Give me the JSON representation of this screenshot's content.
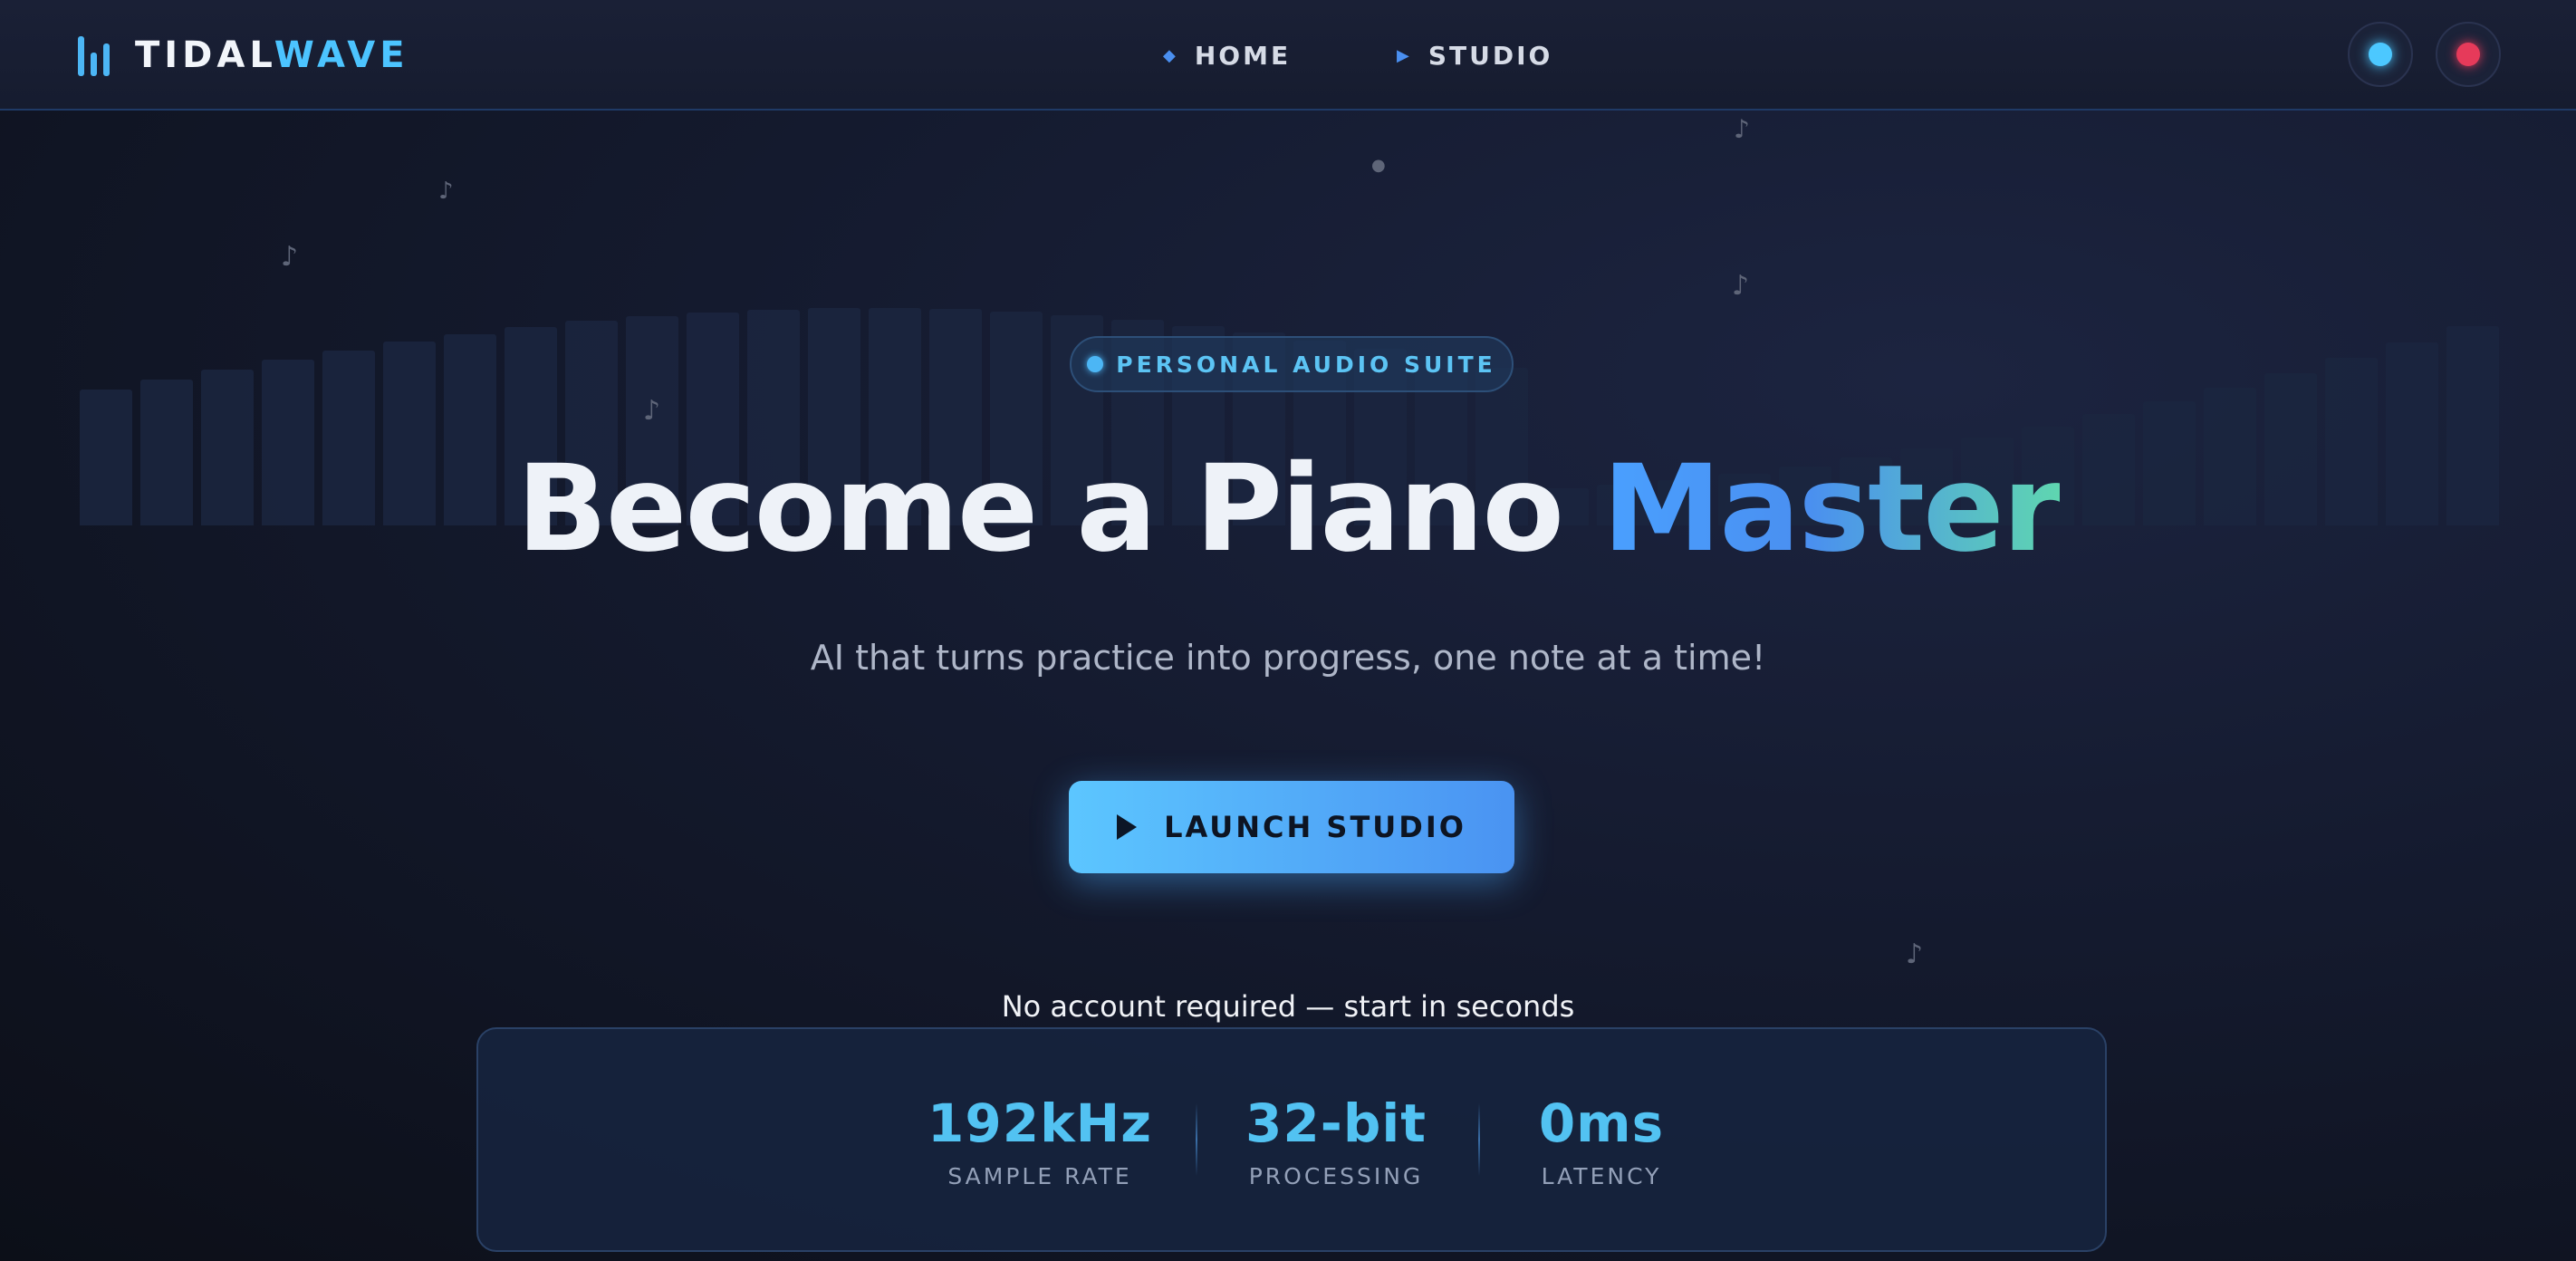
{
  "brand": {
    "word1": "TIDAL",
    "word2": "WAVE",
    "icon": "equalizer-icon"
  },
  "nav": [
    {
      "label": "HOME",
      "icon": "diamond-icon"
    },
    {
      "label": "STUDIO",
      "icon": "play-icon"
    }
  ],
  "badge": {
    "label": "PERSONAL AUDIO SUITE"
  },
  "hero": {
    "title_main": "Become a Piano ",
    "title_accent": "Master"
  },
  "subtitle": "AI that turns practice into progress, one note at a time!",
  "cta": {
    "label": "LAUNCH STUDIO",
    "icon": "play-icon"
  },
  "no_account": "No account required — start in seconds",
  "stats": [
    {
      "value": "192kHz",
      "label": "SAMPLE RATE"
    },
    {
      "value": "32-bit",
      "label": "PROCESSING"
    },
    {
      "value": "0ms",
      "label": "LATENCY"
    }
  ],
  "colors": {
    "accent": "#4cc4ff",
    "record": "#e63a5a",
    "cta_start": "#5cc6ff",
    "cta_end": "#4a93f2"
  }
}
